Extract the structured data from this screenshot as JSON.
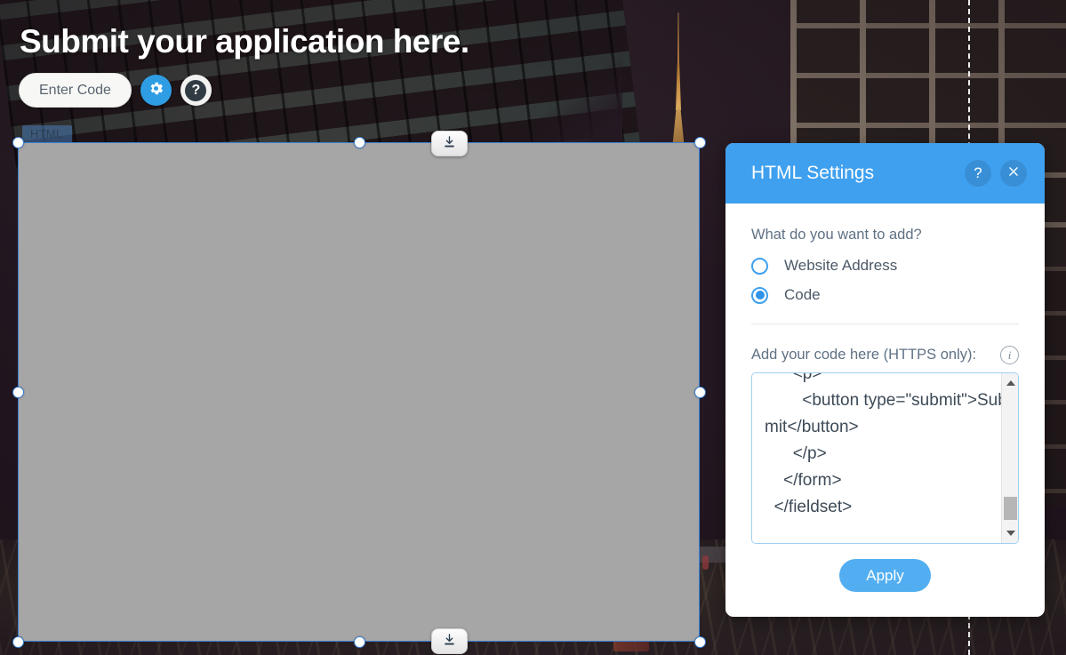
{
  "page": {
    "headline": "Submit your application here."
  },
  "toolbar": {
    "enter_code_label": "Enter Code",
    "gear_icon": "gear-icon",
    "help_icon": "question-mark-icon"
  },
  "canvas": {
    "element_badge": "HTML",
    "download_icon": "download-icon",
    "placeholder_color": "#a6a6a6",
    "selection_border_color": "#3a7fd5",
    "guideline_color": "#ffffff"
  },
  "panel": {
    "title": "HTML Settings",
    "help_icon": "question-mark-icon",
    "close_icon": "close-icon",
    "header_color": "#3fa0ef",
    "question": "What do you want to add?",
    "options": [
      {
        "label": "Website Address",
        "selected": false
      },
      {
        "label": "Code",
        "selected": true
      }
    ],
    "code_label": "Add your code here (HTTPS only):",
    "info_icon": "info-icon",
    "code_value": "      <p>\n        <button type=\"submit\">Submit</button>\n      </p>\n    </form>\n  </fieldset>",
    "scrollbar_up_icon": "chevron-up-icon",
    "scrollbar_down_icon": "chevron-down-icon",
    "apply_label": "Apply",
    "apply_color": "#52aef0"
  }
}
